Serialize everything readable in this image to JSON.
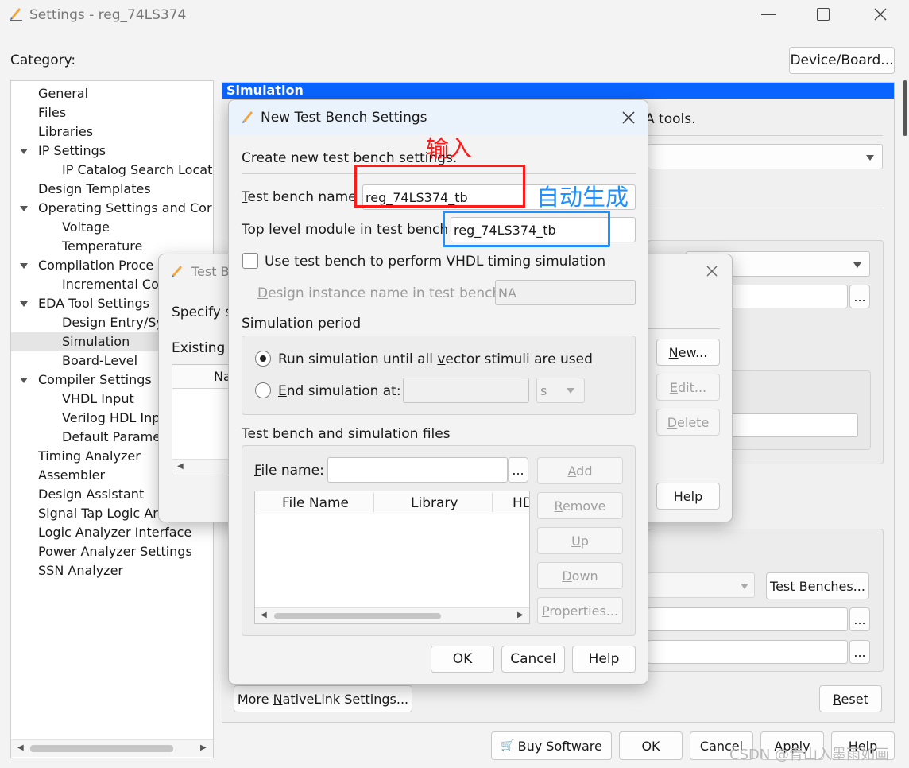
{
  "main_window": {
    "title": "Settings - reg_74LS374",
    "category_label": "Category:",
    "device_board_button": "Device/Board...",
    "buy_software_button": "Buy Software",
    "ok_button": "OK",
    "cancel_button": "Cancel",
    "apply_button": "Apply",
    "help_button": "Help"
  },
  "category_tree": [
    {
      "label": "General",
      "level": 0
    },
    {
      "label": "Files",
      "level": 0
    },
    {
      "label": "Libraries",
      "level": 0
    },
    {
      "label": "IP Settings",
      "level": 0,
      "expanded": true
    },
    {
      "label": "IP Catalog Search Locat",
      "level": 1
    },
    {
      "label": "Design Templates",
      "level": 0
    },
    {
      "label": "Operating Settings and Cor",
      "level": 0,
      "expanded": true
    },
    {
      "label": "Voltage",
      "level": 1
    },
    {
      "label": "Temperature",
      "level": 1
    },
    {
      "label": "Compilation Proce",
      "level": 0,
      "expanded": true
    },
    {
      "label": "Incremental Co",
      "level": 1
    },
    {
      "label": "EDA Tool Settings",
      "level": 0,
      "expanded": true
    },
    {
      "label": "Design Entry/Sy",
      "level": 1
    },
    {
      "label": "Simulation",
      "level": 1,
      "selected": true
    },
    {
      "label": "Board-Level",
      "level": 1
    },
    {
      "label": "Compiler Settings",
      "level": 0,
      "expanded": true
    },
    {
      "label": "VHDL Input",
      "level": 1
    },
    {
      "label": "Verilog HDL Inp",
      "level": 1
    },
    {
      "label": "Default Parame",
      "level": 1
    },
    {
      "label": "Timing Analyzer",
      "level": 0
    },
    {
      "label": "Assembler",
      "level": 0
    },
    {
      "label": "Design Assistant",
      "level": 0
    },
    {
      "label": "Signal Tap Logic Ar",
      "level": 0
    },
    {
      "label": "Logic Analyzer Interface",
      "level": 0
    },
    {
      "label": "Power Analyzer Settings",
      "level": 0
    },
    {
      "label": "SSN Analyzer",
      "level": 0
    }
  ],
  "simulation_panel": {
    "header": "Simulation",
    "tools_text": "A tools.",
    "test_benches_button": "Test Benches...",
    "more_nativelink_button": "More NativeLink Settings...",
    "reset_button": "Reset"
  },
  "test_benches_dialog": {
    "title": "Test B",
    "specify_text": "Specify s",
    "existing_text": "Existing t",
    "column_partial": "Na",
    "new_button": "New...",
    "edit_button": "Edit...",
    "delete_button": "Delete",
    "help_button": "Help"
  },
  "new_tb_dialog": {
    "title": "New Test Bench Settings",
    "create_label": "Create new test bench settings.",
    "tb_name_label": "Test bench name",
    "tb_name_value": "reg_74LS374_tb",
    "top_module_label": "Top level module in test bench",
    "top_module_value": "reg_74LS374_tb",
    "vhdl_timing_label": "Use test bench to perform VHDL timing simulation",
    "design_instance_label": "Design instance name in test bench:",
    "design_instance_value": "NA",
    "sim_period_label": "Simulation period",
    "run_until_label": "Run simulation until all vector stimuli are used",
    "end_sim_label": "End simulation at:",
    "end_sim_unit": "s",
    "files_section_label": "Test bench and simulation files",
    "file_name_label": "File name:",
    "browse_button": "...",
    "add_button": "Add",
    "remove_button": "Remove",
    "up_button": "Up",
    "down_button": "Down",
    "properties_button": "Properties...",
    "columns": [
      "File Name",
      "Library",
      "HD"
    ],
    "ok_button": "OK",
    "cancel_button": "Cancel",
    "help_button": "Help"
  },
  "annotations": {
    "input_label": "输入",
    "auto_label": "自动生成",
    "input_color": "#ff1a1a",
    "auto_color": "#1e90ff"
  },
  "watermark": "CSDN @青山入墨雨如画",
  "colors": {
    "accent": "#0a64ff",
    "window_bg": "#f3f3f3",
    "selected_item": "#e5e5e5"
  }
}
